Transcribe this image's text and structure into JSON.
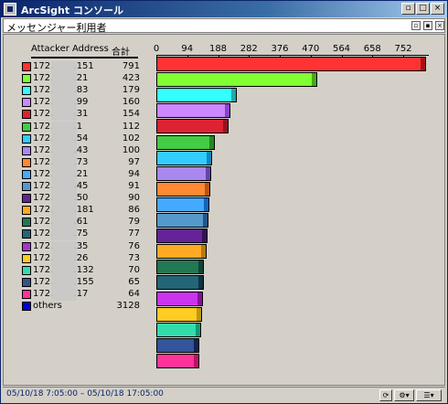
{
  "window": {
    "title": "ArcSight コンソール",
    "controls": {
      "restore": "▫",
      "maximize": "□",
      "close": "×"
    }
  },
  "panel": {
    "title": "メッセンジャー利用者",
    "controls": {
      "a": "▫",
      "b": "▪",
      "close": "×"
    }
  },
  "table": {
    "col_address": "Attacker Address",
    "col_total": "合計"
  },
  "chart_data": {
    "type": "bar",
    "orientation": "horizontal",
    "xlim": [
      0,
      800
    ],
    "x_ticks": [
      "0",
      "94",
      "188",
      "282",
      "376",
      "470",
      "564",
      "658",
      "752"
    ],
    "categories": [
      "172.*.151",
      "172.*.21",
      "172.*.83",
      "172.*.99",
      "172.*.31",
      "172.*.1",
      "172.*.54",
      "172.*.43",
      "172.*.73",
      "172.*.21",
      "172.*.45",
      "172.*.50",
      "172.*.181",
      "172.*.61",
      "172.*.75",
      "172.*.35",
      "172.*.26",
      "172.*.132",
      "172.*.155",
      "172.*.17",
      "others"
    ],
    "labels_visible": [
      {
        "prefix": "172.",
        "suffix": ".151"
      },
      {
        "prefix": "172.",
        "suffix": ".21"
      },
      {
        "prefix": "172.",
        "suffix": ".83"
      },
      {
        "prefix": "172.",
        "suffix": ".99"
      },
      {
        "prefix": "172.",
        "suffix": ".31"
      },
      {
        "prefix": "172.",
        "suffix": ".1"
      },
      {
        "prefix": "172.",
        "suffix": ".54"
      },
      {
        "prefix": "172.",
        "suffix": ".43"
      },
      {
        "prefix": "172.",
        "suffix": ".73"
      },
      {
        "prefix": "172.",
        "suffix": ".21"
      },
      {
        "prefix": "172.",
        "suffix": ".45"
      },
      {
        "prefix": "172.",
        "suffix": ".50"
      },
      {
        "prefix": "172.",
        "suffix": ".181"
      },
      {
        "prefix": "172.",
        "suffix": ".61"
      },
      {
        "prefix": "172.",
        "suffix": ".75"
      },
      {
        "prefix": "172.",
        "suffix": ".35"
      },
      {
        "prefix": "172.",
        "suffix": ".26"
      },
      {
        "prefix": "172.",
        "suffix": ".132"
      },
      {
        "prefix": "172.",
        "suffix": ".155"
      },
      {
        "prefix": "172.",
        "suffix": ".17"
      },
      {
        "prefix": "others",
        "suffix": ""
      }
    ],
    "values": [
      791,
      423,
      179,
      160,
      154,
      112,
      102,
      100,
      97,
      94,
      91,
      90,
      86,
      79,
      77,
      76,
      73,
      70,
      65,
      64,
      3128
    ],
    "colors": [
      "#ff3333",
      "#80ff33",
      "#33ffff",
      "#cc88ff",
      "#dd2233",
      "#44cc44",
      "#33ccff",
      "#aa88ee",
      "#ff8833",
      "#44aaff",
      "#5599cc",
      "#662299",
      "#ffaa22",
      "#227755",
      "#226677",
      "#aa33cc",
      "#ffcc22",
      "#33ddaa",
      "#335588",
      "#ff3399",
      "#0000cc"
    ],
    "bars_drawn": [
      {
        "value": 791,
        "color": "#ff3333",
        "cap": "#aa1111"
      },
      {
        "value": 423,
        "color": "#80ff33",
        "cap": "#44aa11"
      },
      {
        "value": 179,
        "color": "#33ffff",
        "cap": "#22aaaa"
      },
      {
        "value": 160,
        "color": "#cc88ff",
        "cap": "#8844cc"
      },
      {
        "value": 154,
        "color": "#dd2233",
        "cap": "#991122"
      },
      {
        "value": 112,
        "color": "#44cc44",
        "cap": "#228822"
      },
      {
        "value": 102,
        "color": "#33ccff",
        "cap": "#1188bb"
      },
      {
        "value": 100,
        "color": "#aa88ee",
        "cap": "#6644aa"
      },
      {
        "value": 97,
        "color": "#ff8833",
        "cap": "#bb5511"
      },
      {
        "value": 94,
        "color": "#44aaff",
        "cap": "#1166bb"
      },
      {
        "value": 91,
        "color": "#5599cc",
        "cap": "#225588"
      },
      {
        "value": 90,
        "color": "#662299",
        "cap": "#331155"
      },
      {
        "value": 86,
        "color": "#ffaa22",
        "cap": "#bb7711"
      },
      {
        "value": 79,
        "color": "#227755",
        "cap": "#114433"
      },
      {
        "value": 77,
        "color": "#226677",
        "cap": "#113344"
      },
      {
        "value": 76,
        "color": "#cc33ee",
        "cap": "#881199"
      },
      {
        "value": 73,
        "color": "#ffcc22",
        "cap": "#bb9911"
      },
      {
        "value": 70,
        "color": "#33ddaa",
        "cap": "#119977"
      },
      {
        "value": 65,
        "color": "#335599",
        "cap": "#112255"
      },
      {
        "value": 64,
        "color": "#ff3399",
        "cap": "#bb1166"
      }
    ],
    "title": "",
    "xlabel": "",
    "ylabel": ""
  },
  "status": {
    "time_range": "05/10/18 7:05:00 – 05/10/18 17:05:00"
  }
}
